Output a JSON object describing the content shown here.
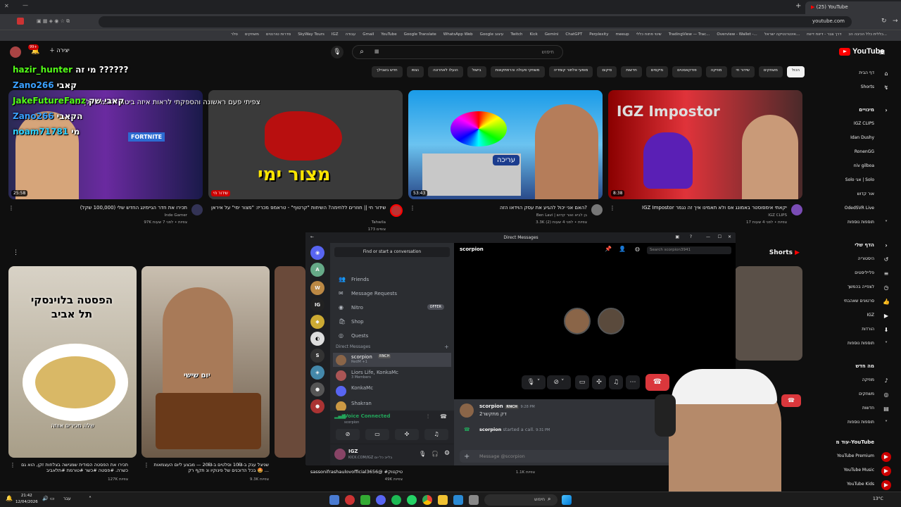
{
  "browser": {
    "tab_title": "(25) YouTube",
    "url": "youtube.com",
    "bookmarks": [
      "כללית כלל הכיבה הכ...",
      "דרך צבר - דיווח דיווח",
      "אינטרנטיקה ישראל...",
      "Overview - Wallet -...",
      "TradingView — Trac...",
      "שינוי פתוח כללי",
      "meeup",
      "Perplexity",
      "ChatGPT",
      "Gemini",
      "Kick",
      "Twitch",
      "Google עיצוב",
      "WhatsApp Web",
      "Google Translate",
      "YouTube",
      "Gmail",
      "עבודה",
      "IGZ",
      "SkyWay Tours",
      "סדרות טורנטים",
      "משחקים",
      "סלר"
    ]
  },
  "youtube": {
    "logo": "YouTube",
    "search_placeholder": "חיפוש",
    "create_label": "יצירה",
    "notif_count": "99+",
    "chips": [
      "הכול",
      "משחקים",
      "שידור חי",
      "מוזיקה",
      "פודקאסטים",
      "מיקסים",
      "חדשות",
      "סיקום",
      "מופעי אלתור קומדיה",
      "משחקי פעולה והרפתקאות",
      "בישול",
      "הועלו לאחרונה",
      "נצפו",
      "חדש בשבילך"
    ],
    "sidebar": {
      "home": "דף הבית",
      "shorts": "Shorts",
      "subs_header": "מינויים",
      "subs": [
        "IGZ CLIPS",
        "Idan Dushy",
        "RonenGG",
        "niv gilboa",
        "Solo אגי | Solo",
        "אור קדוש",
        "OdedSVR Live"
      ],
      "more1": "תוספות נוספות",
      "you_header": "הדף שלי",
      "you_items": [
        "היסטוריה",
        "פלייליסטים",
        "לצפייה בהמשך",
        "סרטונים שאהבתי",
        "IGZ",
        "הורדות"
      ],
      "more2": "תוספות נוספות",
      "explore_header": "מה חדש",
      "explore": [
        "מוזיקה",
        "משחקים",
        "חדשות"
      ],
      "more3": "תוספות נוספות",
      "more_yt_header": "עוד מ-YouTube",
      "more_yt": [
        "YouTube Premium",
        "YouTube Music",
        "YouTube Kids"
      ]
    },
    "videos": [
      {
        "title": "IGZ Impostor יקאתי אימפוסטר באמונג אס ולא תאמינו איך זה נגמר",
        "channel": "IGZ CLIPS",
        "meta": "17 צפיות • לפני 4 שעות",
        "duration": "8:38",
        "thumb_text": "IGZ Impostor"
      },
      {
        "title": "האם אני יכול להגיע את עסק הוידאו הזה?",
        "channel": "Ben Lavi | בן לביא ואור קדוש",
        "meta": "3.3K צפיות • לפני 4 שעות (2)",
        "duration": "53:43",
        "thumb_text": "עריכה"
      },
      {
        "title": "שידור חי || חוזרים ללחימה? השיחות \"קרטוף\" - טראמפ מכריז: \"מצור ימי\" על איראן",
        "channel": "Tahwila",
        "meta": "צופים 173",
        "duration": "שידור חי",
        "thumb_text": "מצור ימי",
        "thumb_sub": "צפיתי פעם ראשונה והספקתי לראות איזה ביטוח לאומי הולך שם"
      },
      {
        "title": "תכירו את חדר הגיימינג החדש שלי (100,000 שקל)",
        "channel": "Inde Gamer",
        "meta": "97K צפיות • לפני 7 שעות",
        "duration": "25:58",
        "thumb_text": "FORTNITE"
      }
    ],
    "shorts_header": "Shorts",
    "shorts": [
      {
        "title": "תכירו את הפסטה הסודית שמגישה בצלחות זקן, הוא גם כשרה. #פסטה #כשר #טורמת #תלאביב",
        "meta": "127K צפיות",
        "overlay": "הפסטה בלוינסקי תל אביב",
        "caption": "שלה מכירים אותה"
      },
      {
        "title": "שניצל ענק ב-10₪ וסלטים ב-20₪ — מבצע ליום העצמאות 🤩 בכל הדוכנים של פינוקיו ונ תקף רק ...",
        "meta": "9.3K צפיות",
        "overlay": "יום שישי"
      },
      {
        "title": "sassonifrashaulovofficial3656@ #טיקטוק",
        "meta": "49K צפיות"
      },
      {
        "title": "",
        "meta": "1.1K צפיות"
      }
    ]
  },
  "stream_chat": [
    {
      "user": "hazir_hunter",
      "msg": "מי זה ??????",
      "color": "#53fc18"
    },
    {
      "user": "Zano266",
      "msg": "קאבי",
      "color": "#3aa0ff"
    },
    {
      "user": "JakeFutureFanz",
      "msg": "קאבי שק",
      "color": "#53fc18"
    },
    {
      "user": "Zano266",
      "msg": "הקאבי",
      "color": "#3aa0ff"
    },
    {
      "user": "noam71781",
      "msg": "מי",
      "color": "#2fd1ff"
    }
  ],
  "discord": {
    "title": "Direct Messages",
    "find_placeholder": "Find or start a conversation",
    "nav": [
      {
        "label": "Friends",
        "icon": "👥"
      },
      {
        "label": "Message Requests",
        "icon": "✉"
      },
      {
        "label": "Nitro",
        "icon": "◉",
        "badge": "OFFER"
      },
      {
        "label": "Shop",
        "icon": "🛍"
      },
      {
        "label": "Quests",
        "icon": "◎"
      }
    ],
    "dm_header": "Direct Messages",
    "dms": [
      {
        "name": "scorpion",
        "sub": "RedM +1",
        "tag": "RNCH"
      },
      {
        "name": "Liors Life, KonkaMc",
        "sub": "3 Members"
      },
      {
        "name": "KonkaMc",
        "sub": ""
      },
      {
        "name": "Shakran",
        "sub": ""
      }
    ],
    "voice_status": "Voice Connected",
    "voice_sub": "scorpion",
    "user_name": "IGZ",
    "user_status": "KICK.COM/IGZ בלייב כל יום",
    "channel_name": "scorpion",
    "search_placeholder": "Search scorpion3941",
    "messages": [
      {
        "user": "scorpion",
        "tag": "RNCH",
        "time": "9:28 PM",
        "text": "2דק מתקשר"
      },
      {
        "user": "scorpion",
        "text": "started a call.",
        "time": "9:31 PM"
      }
    ],
    "message_placeholder": "Message @scorpion"
  },
  "taskbar": {
    "time": "21:42",
    "date": "12/04/2026",
    "search": "חיפוש",
    "weather": "13°C",
    "lang": "עבר"
  }
}
